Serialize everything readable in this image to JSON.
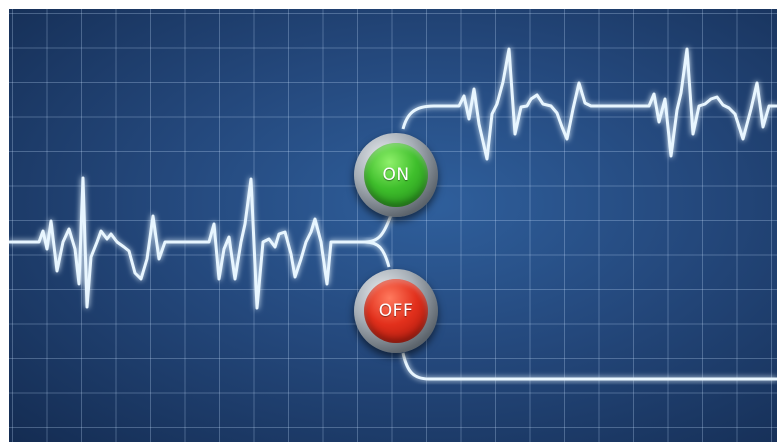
{
  "buttons": {
    "on_label": "ON",
    "off_label": "OFF"
  },
  "colors": {
    "background": "#24487c",
    "trace": "#e8f6ff",
    "trace_glow": "#7fd4ff",
    "on_button": "#3fbf2c",
    "off_button": "#e2301c"
  }
}
